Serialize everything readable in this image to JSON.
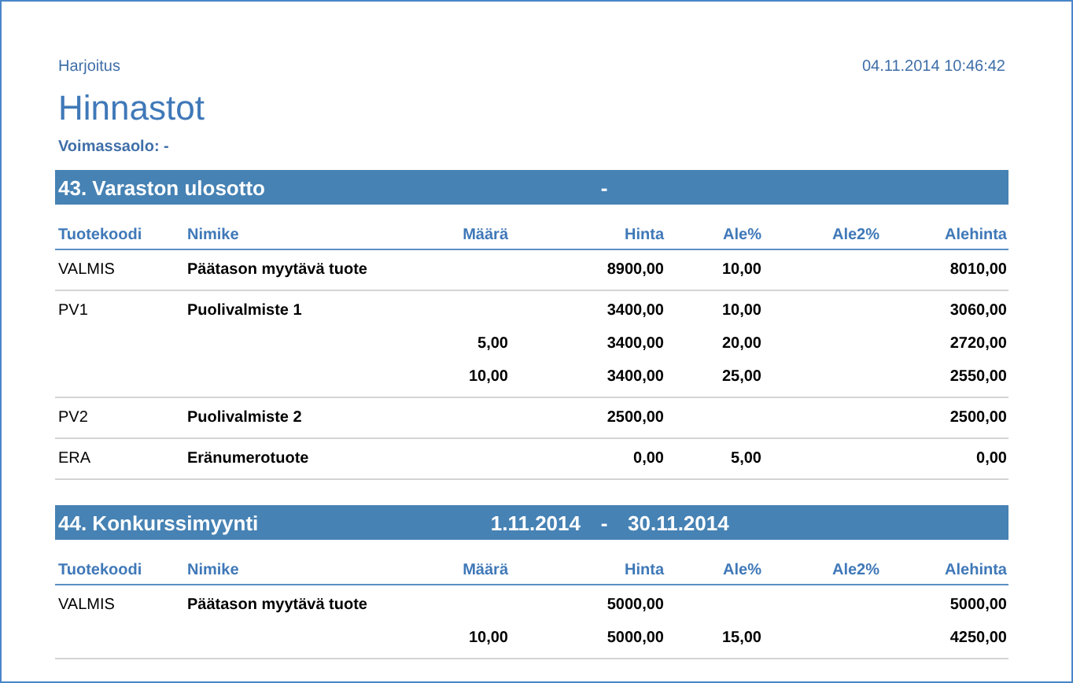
{
  "header": {
    "company": "Harjoitus",
    "timestamp": "04.11.2014 10:46:42",
    "title": "Hinnastot",
    "validity": "Voimassaolo: -"
  },
  "sections": [
    {
      "title": "43. Varaston ulosotto",
      "separator": "-",
      "columns": [
        "Tuotekoodi",
        "Nimike",
        "Määrä",
        "Hinta",
        "Ale%",
        "Ale2%",
        "Alehinta"
      ],
      "groups": [
        [
          {
            "code": "VALMIS",
            "name": "Päätason myytävä tuote",
            "price": "8900,00",
            "ale": "10,00",
            "net": "8010,00"
          }
        ],
        [
          {
            "code": "PV1",
            "name": "Puolivalmiste 1",
            "price": "3400,00",
            "ale": "10,00",
            "net": "3060,00"
          },
          {
            "qty": "5,00",
            "price": "3400,00",
            "ale": "20,00",
            "net": "2720,00"
          },
          {
            "qty": "10,00",
            "price": "3400,00",
            "ale": "25,00",
            "net": "2550,00"
          }
        ],
        [
          {
            "code": "PV2",
            "name": "Puolivalmiste 2",
            "price": "2500,00",
            "net": "2500,00"
          }
        ],
        [
          {
            "code": "ERA",
            "name": "Eränumerotuote",
            "price": "0,00",
            "ale": "5,00",
            "net": "0,00"
          }
        ]
      ]
    },
    {
      "title": "44. Konkurssimyynti",
      "from": "1.11.2014",
      "separator": "-",
      "to": "30.11.2014",
      "columns": [
        "Tuotekoodi",
        "Nimike",
        "Määrä",
        "Hinta",
        "Ale%",
        "Ale2%",
        "Alehinta"
      ],
      "groups": [
        [
          {
            "code": "VALMIS",
            "name": "Päätason myytävä tuote",
            "price": "5000,00",
            "net": "5000,00"
          },
          {
            "qty": "10,00",
            "price": "5000,00",
            "ale": "15,00",
            "net": "4250,00"
          }
        ]
      ]
    }
  ]
}
